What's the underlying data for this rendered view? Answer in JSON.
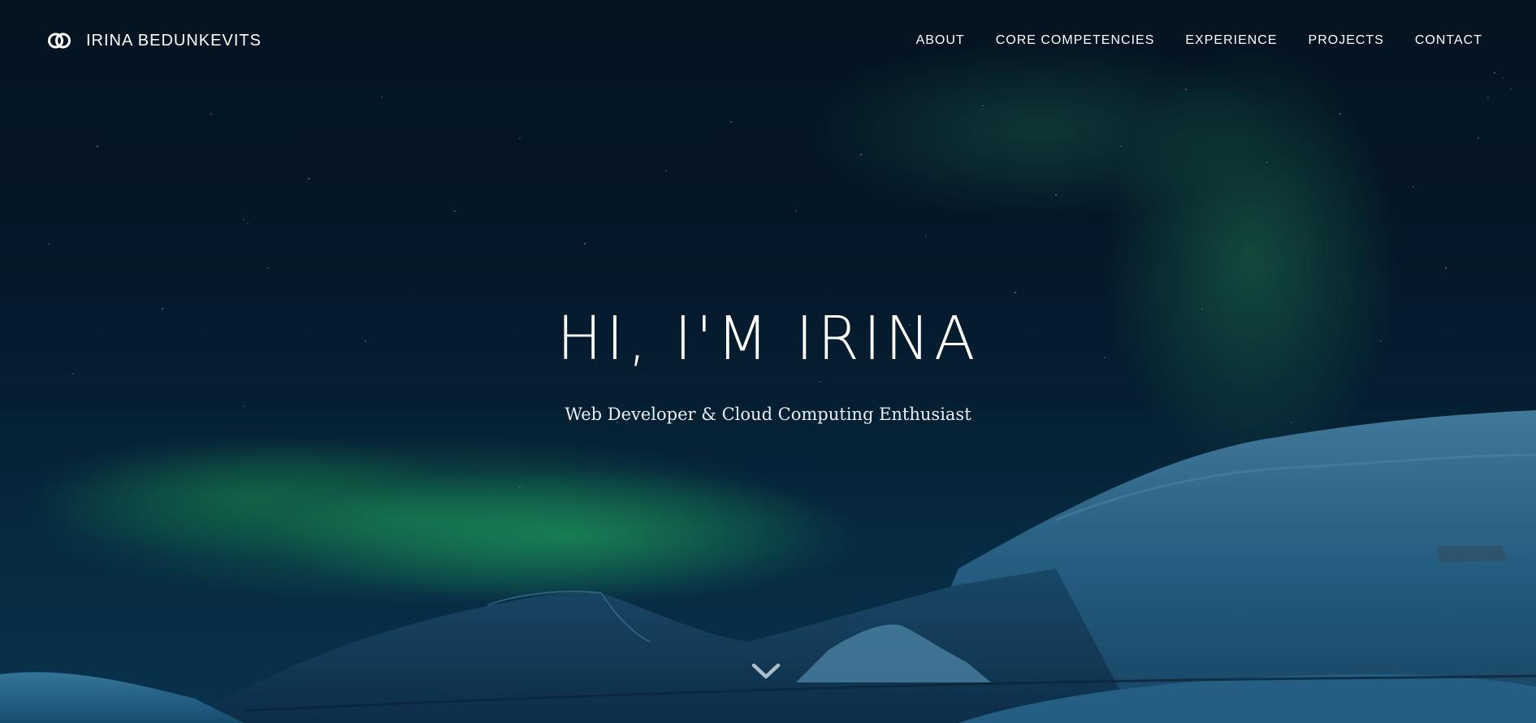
{
  "navbar": {
    "brand_name": "IRINA BEDUNKEVITS",
    "brand_icon": "interlocked-rings-icon",
    "links": [
      {
        "label": "ABOUT"
      },
      {
        "label": "CORE COMPETENCIES"
      },
      {
        "label": "EXPERIENCE"
      },
      {
        "label": "PROJECTS"
      },
      {
        "label": "CONTACT"
      }
    ]
  },
  "hero": {
    "title": "HI, I'M IRINA",
    "subtitle": "Web Developer & Cloud Computing Enthusiast",
    "background": "aurora-over-snowy-mountains-photo",
    "scroll_icon": "chevron-down-icon"
  },
  "colors": {
    "text": "#ffffff",
    "sky_dark": "#05182a",
    "aurora_green": "#28c86e",
    "snow_blue": "#2f7fa8"
  }
}
